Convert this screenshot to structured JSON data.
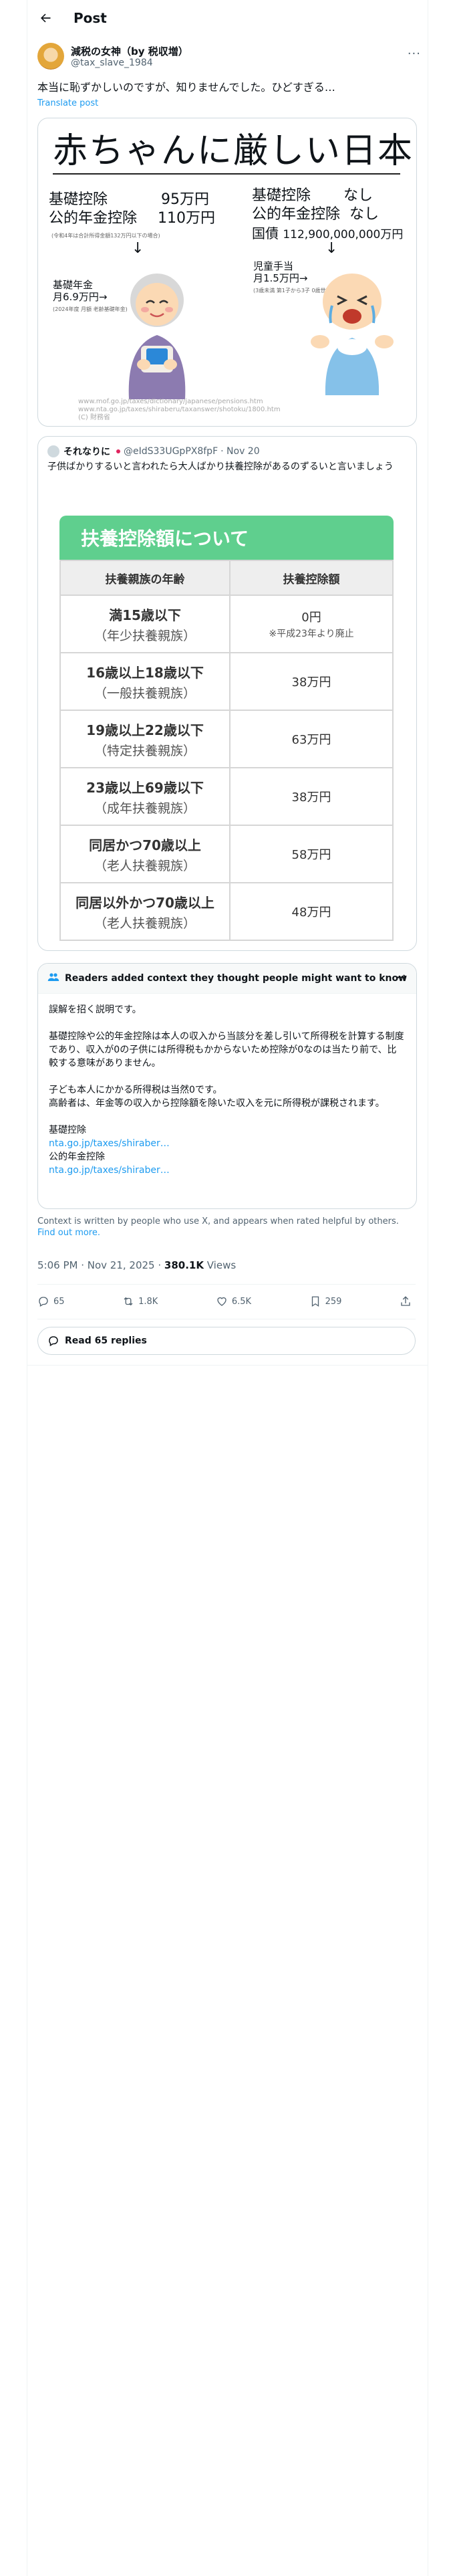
{
  "topbar": {
    "title": "Post"
  },
  "author": {
    "name": "減税の女神（by 税収増）",
    "handle": "@tax_slave_1984"
  },
  "tweet": {
    "text": "本当に恥ずかしいのですが、知りませんでした。ひどすぎる…",
    "translate": "Translate post"
  },
  "media": {
    "title": "赤ちゃんに厳しい日本",
    "left": {
      "row1_label": "基礎控除",
      "row1_value": "95万円",
      "row2_label": "公的年金控除",
      "row2_value": "110万円",
      "note": "(令和4年は合計所得金額132万円以下の場合)",
      "pension": "基礎年金",
      "pension_amount": "月6.9万円→",
      "pension_note": "(2024年度 月額 老齢基礎年金)"
    },
    "right": {
      "row1_label": "基礎控除",
      "row1_value": "なし",
      "row2_label": "公的年金控除",
      "row2_value": "なし",
      "row3_label": "国債",
      "row3_value": "112,900,000,000万円",
      "allowance": "児童手当",
      "allowance_amount": "月1.5万円→",
      "allowance_note": "(3歳未満 第1子から3子 0歳世帯)"
    },
    "url1": "www.mof.go.jp/taxes/dictionary/japanese/pensions.htm",
    "url2": "www.nta.go.jp/taxes/shiraberu/taxanswer/shotoku/1800.htm",
    "credit": "(C) 財務省"
  },
  "quote": {
    "name": "それなりに",
    "handle": "@eIdS33UGpPX8fpF",
    "date": "· Nov 20",
    "text": "子供ばかりするいと言われたら大人ばかり扶養控除があるのずるいと言いましょう",
    "table_title": "扶養控除額について",
    "col1": "扶養親族の年齢",
    "col2": "扶養控除額",
    "rows": [
      {
        "age": "満15歳以下",
        "kind": "（年少扶養親族）",
        "amount": "0円",
        "note": "※平成23年より廃止"
      },
      {
        "age": "16歳以上18歳以下",
        "kind": "（一般扶養親族）",
        "amount": "38万円",
        "note": ""
      },
      {
        "age": "19歳以上22歳以下",
        "kind": "（特定扶養親族）",
        "amount": "63万円",
        "note": ""
      },
      {
        "age": "23歳以上69歳以下",
        "kind": "（成年扶養親族）",
        "amount": "38万円",
        "note": ""
      },
      {
        "age": "同居かつ70歳以上",
        "kind": "（老人扶養親族）",
        "amount": "58万円",
        "note": ""
      },
      {
        "age": "同居以外かつ70歳以上",
        "kind": "（老人扶養親族）",
        "amount": "48万円",
        "note": ""
      }
    ]
  },
  "community_note": {
    "header": "Readers added context they thought people might want to know",
    "p1": "誤解を招く説明です。",
    "p2": "基礎控除や公的年金控除は本人の収入から当該分を差し引いて所得税を計算する制度であり、収入が0の子供には所得税もかからないため控除が0なのは当たり前で、比較する意味がありません。",
    "p3a": "子ども本人にかかる所得税は当然0です。",
    "p3b": "高齢者は、年金等の収入から控除額を除いた収入を元に所得税が課税されます。",
    "src1_label": "基礎控除",
    "src1_link": "nta.go.jp/taxes/shiraber…",
    "src2_label": "公的年金控除",
    "src2_link": "nta.go.jp/taxes/shiraber…"
  },
  "footnote": {
    "text": "Context is written by people who use X, and appears when rated helpful by others.",
    "link": "Find out more."
  },
  "meta": {
    "time": "5:06 PM · Nov 21, 2025 · ",
    "views": "380.1K",
    "views_label": " Views"
  },
  "actions": {
    "replies": "65",
    "reposts": "1.8K",
    "likes": "6.5K",
    "bookmarks": "259"
  },
  "read_replies": "Read 65 replies"
}
